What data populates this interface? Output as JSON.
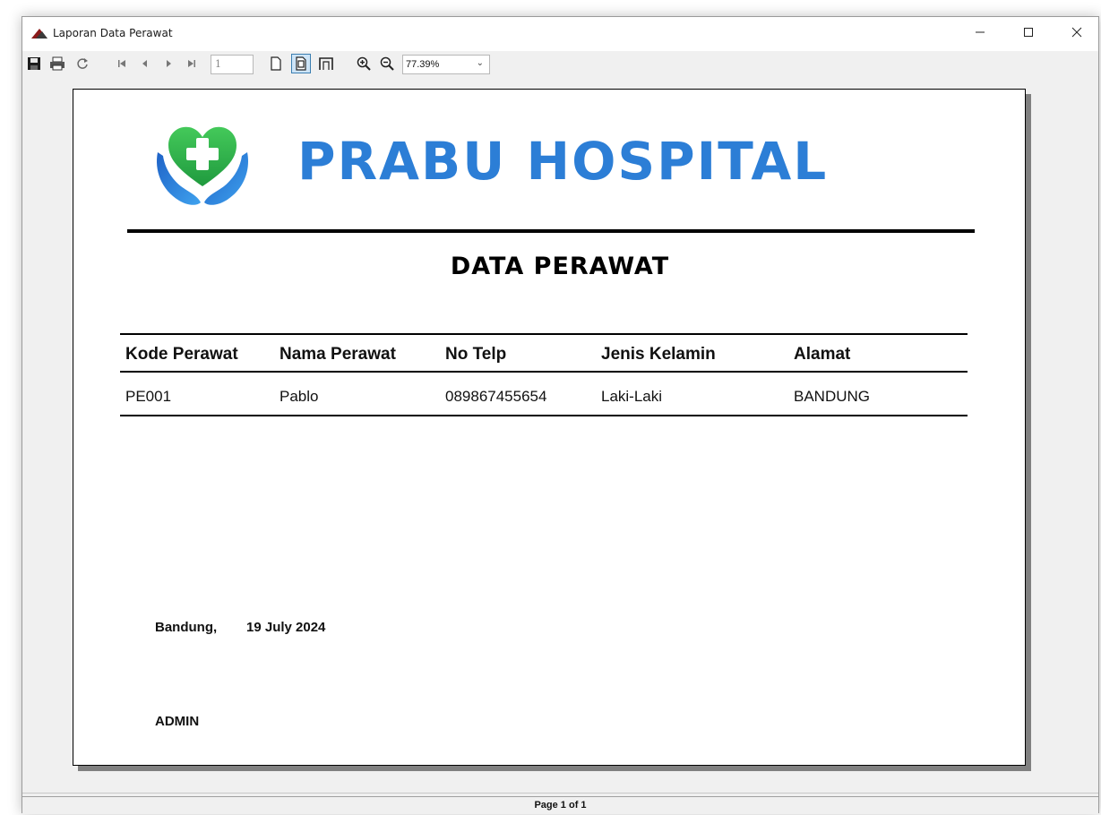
{
  "window": {
    "title": "Laporan Data Perawat"
  },
  "toolbar": {
    "page_number": "1",
    "zoom": "77.39%"
  },
  "report": {
    "hospital_name": "PRABU HOSPITAL",
    "title": "DATA PERAWAT",
    "columns": [
      "Kode Perawat",
      "Nama Perawat",
      "No Telp",
      "Jenis Kelamin",
      "Alamat"
    ],
    "rows": [
      [
        "PE001",
        "Pablo",
        "089867455654",
        "Laki-Laki",
        "BANDUNG"
      ]
    ],
    "place": "Bandung,",
    "date": "19 July 2024",
    "signer": "ADMIN"
  },
  "status": {
    "page_info": "Page 1 of 1"
  },
  "colors": {
    "brand_blue": "#2c7ed6",
    "logo_green": "#2fb34b"
  }
}
